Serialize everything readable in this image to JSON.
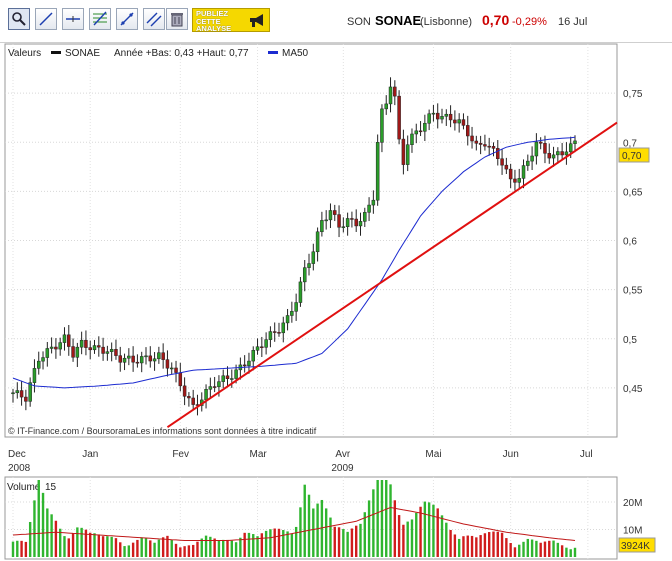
{
  "toolbar": {
    "tools": [
      {
        "name": "zoom-tool",
        "icon": "magnifier-icon"
      },
      {
        "name": "line-tool",
        "icon": "line-icon"
      },
      {
        "name": "horizontal-line-tool",
        "icon": "horizontal-line-icon"
      },
      {
        "name": "fibonacci-tool",
        "icon": "fibonacci-icon"
      },
      {
        "name": "trend-tool",
        "icon": "trend-icon"
      },
      {
        "name": "channel-tool",
        "icon": "channel-icon"
      },
      {
        "name": "delete-tool",
        "icon": "trash-icon"
      }
    ],
    "promo_label": "PUBLIEZ\nCETTE\nANALYSE",
    "promo_icon": "megaphone-icon"
  },
  "quote": {
    "prefix": "SON",
    "name": "SONAE",
    "market": "(Lisbonne)",
    "price": "0,70",
    "change": "-0,29%",
    "date": "16 Jul"
  },
  "chart_data": [
    {
      "type": "candlestick",
      "legend": {
        "values_label": "Valeurs",
        "series_label": "SONAE",
        "range_label": "Année +Bas: 0,43 +Haut: 0,77",
        "ma_label": "MA50"
      },
      "ylim": [
        0.4,
        0.8
      ],
      "y_ticks": [
        "0,45",
        "0,5",
        "0,55",
        "0,6",
        "0,65",
        "0,7",
        "0,75"
      ],
      "last_value": "0,70",
      "x_months": [
        {
          "label": "Dec",
          "year": "2008"
        },
        {
          "label": "Jan",
          "year": ""
        },
        {
          "label": "Fev",
          "year": ""
        },
        {
          "label": "Mar",
          "year": ""
        },
        {
          "label": "Avr",
          "year": "2009"
        },
        {
          "label": "Mai",
          "year": ""
        },
        {
          "label": "Jun",
          "year": ""
        },
        {
          "label": "Jul",
          "year": ""
        }
      ],
      "close_anchors": [
        [
          0,
          0.445
        ],
        [
          3,
          0.44
        ],
        [
          6,
          0.48
        ],
        [
          9,
          0.49
        ],
        [
          12,
          0.5
        ],
        [
          14,
          0.485
        ],
        [
          16,
          0.495
        ],
        [
          19,
          0.49
        ],
        [
          22,
          0.488
        ],
        [
          25,
          0.48
        ],
        [
          28,
          0.478
        ],
        [
          31,
          0.48
        ],
        [
          34,
          0.482
        ],
        [
          37,
          0.47
        ],
        [
          40,
          0.445
        ],
        [
          42,
          0.43
        ],
        [
          44,
          0.44
        ],
        [
          47,
          0.455
        ],
        [
          50,
          0.46
        ],
        [
          53,
          0.47
        ],
        [
          56,
          0.485
        ],
        [
          59,
          0.5
        ],
        [
          62,
          0.51
        ],
        [
          64,
          0.52
        ],
        [
          66,
          0.54
        ],
        [
          68,
          0.57
        ],
        [
          70,
          0.59
        ],
        [
          72,
          0.62
        ],
        [
          74,
          0.63
        ],
        [
          76,
          0.615
        ],
        [
          78,
          0.62
        ],
        [
          80,
          0.618
        ],
        [
          82,
          0.625
        ],
        [
          84,
          0.645
        ],
        [
          85,
          0.7
        ],
        [
          86,
          0.73
        ],
        [
          87,
          0.74
        ],
        [
          88,
          0.76
        ],
        [
          89,
          0.745
        ],
        [
          90,
          0.7
        ],
        [
          91,
          0.68
        ],
        [
          92,
          0.7
        ],
        [
          94,
          0.71
        ],
        [
          96,
          0.72
        ],
        [
          98,
          0.73
        ],
        [
          100,
          0.725
        ],
        [
          102,
          0.725
        ],
        [
          104,
          0.72
        ],
        [
          106,
          0.71
        ],
        [
          108,
          0.695
        ],
        [
          110,
          0.7
        ],
        [
          112,
          0.69
        ],
        [
          114,
          0.68
        ],
        [
          116,
          0.66
        ],
        [
          118,
          0.665
        ],
        [
          120,
          0.68
        ],
        [
          122,
          0.7
        ],
        [
          124,
          0.69
        ],
        [
          126,
          0.685
        ],
        [
          128,
          0.69
        ],
        [
          130,
          0.695
        ],
        [
          131,
          0.7
        ]
      ],
      "ma50": [
        [
          0,
          0.46
        ],
        [
          5,
          0.452
        ],
        [
          12,
          0.45
        ],
        [
          20,
          0.452
        ],
        [
          28,
          0.455
        ],
        [
          35,
          0.462
        ],
        [
          42,
          0.468
        ],
        [
          50,
          0.47
        ],
        [
          58,
          0.472
        ],
        [
          66,
          0.475
        ],
        [
          72,
          0.485
        ],
        [
          78,
          0.51
        ],
        [
          82,
          0.535
        ],
        [
          86,
          0.56
        ],
        [
          90,
          0.59
        ],
        [
          95,
          0.625
        ],
        [
          100,
          0.65
        ],
        [
          105,
          0.67
        ],
        [
          110,
          0.685
        ],
        [
          115,
          0.695
        ],
        [
          120,
          0.7
        ],
        [
          125,
          0.703
        ],
        [
          131,
          0.705
        ]
      ],
      "trendline": [
        [
          36,
          0.41
        ],
        [
          142,
          0.72
        ]
      ],
      "annotation": "© IT-Finance.com / BoursoramaLes informations sont données à titre indicatif",
      "colors": {
        "up": "#2a9d2a",
        "down": "#a01818",
        "ma": "#1c2bd0",
        "trend": "#e01010",
        "price_box": "#ffdd00"
      }
    },
    {
      "type": "bar",
      "legend": {
        "label": "Volume",
        "period": "15"
      },
      "y_ticks": [
        "20M",
        "10M"
      ],
      "ylim_millions": [
        0,
        28
      ],
      "last_value": "3924K",
      "volume_anchors_millions": [
        [
          0,
          8
        ],
        [
          3,
          5
        ],
        [
          6,
          22
        ],
        [
          8,
          14
        ],
        [
          10,
          12
        ],
        [
          12,
          9
        ],
        [
          15,
          11
        ],
        [
          18,
          7
        ],
        [
          21,
          6
        ],
        [
          24,
          7
        ],
        [
          27,
          5
        ],
        [
          30,
          6
        ],
        [
          33,
          4
        ],
        [
          36,
          7
        ],
        [
          39,
          5
        ],
        [
          42,
          4
        ],
        [
          45,
          6
        ],
        [
          48,
          5
        ],
        [
          51,
          7
        ],
        [
          54,
          9
        ],
        [
          57,
          6
        ],
        [
          60,
          8
        ],
        [
          63,
          10
        ],
        [
          66,
          13
        ],
        [
          68,
          24
        ],
        [
          70,
          14
        ],
        [
          72,
          16
        ],
        [
          75,
          10
        ],
        [
          78,
          13
        ],
        [
          81,
          11
        ],
        [
          84,
          19
        ],
        [
          86,
          26
        ],
        [
          88,
          24
        ],
        [
          90,
          18
        ],
        [
          93,
          14
        ],
        [
          96,
          16
        ],
        [
          99,
          14
        ],
        [
          102,
          10
        ],
        [
          105,
          9
        ],
        [
          108,
          6
        ],
        [
          111,
          7
        ],
        [
          114,
          8
        ],
        [
          117,
          5
        ],
        [
          120,
          6
        ],
        [
          123,
          4
        ],
        [
          126,
          5
        ],
        [
          129,
          4
        ],
        [
          131,
          4
        ]
      ],
      "volume_ma_anchors_millions": [
        [
          0,
          8
        ],
        [
          10,
          9
        ],
        [
          20,
          8
        ],
        [
          30,
          7
        ],
        [
          40,
          6
        ],
        [
          50,
          6
        ],
        [
          60,
          7
        ],
        [
          70,
          10
        ],
        [
          80,
          13
        ],
        [
          88,
          18
        ],
        [
          95,
          16
        ],
        [
          105,
          12
        ],
        [
          115,
          9
        ],
        [
          125,
          7
        ],
        [
          131,
          6
        ]
      ]
    }
  ]
}
